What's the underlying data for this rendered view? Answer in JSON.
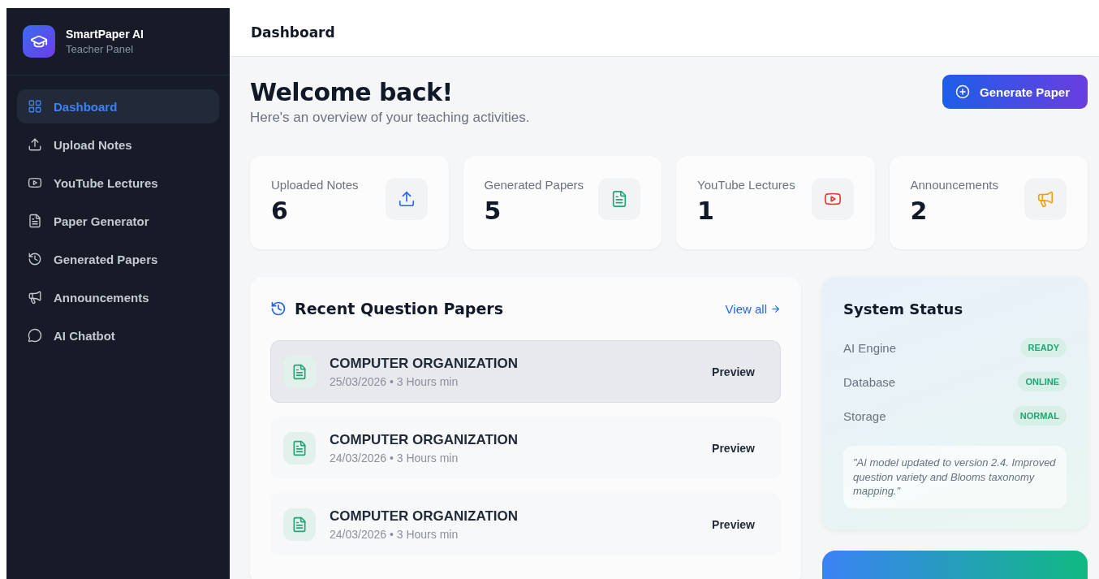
{
  "brand": {
    "title": "SmartPaper AI",
    "subtitle": "Teacher Panel"
  },
  "sidebar": {
    "items": [
      {
        "label": "Dashboard",
        "kind": "grid",
        "selected": true
      },
      {
        "label": "Upload Notes",
        "kind": "upload",
        "selected": false
      },
      {
        "label": "YouTube Lectures",
        "kind": "video",
        "selected": false
      },
      {
        "label": "Paper Generator",
        "kind": "document",
        "selected": false
      },
      {
        "label": "Generated Papers",
        "kind": "history",
        "selected": false
      },
      {
        "label": "Announcements",
        "kind": "megaphone",
        "selected": false
      },
      {
        "label": "AI Chatbot",
        "kind": "chat",
        "selected": false
      }
    ]
  },
  "header": {
    "title": "Dashboard"
  },
  "welcome": {
    "title": "Welcome back!",
    "subtitle": "Here's an overview of your teaching activities."
  },
  "primary_button": "Generate Paper",
  "stats": [
    {
      "label": "Uploaded Notes",
      "value": "6",
      "kind": "upload"
    },
    {
      "label": "Generated Papers",
      "value": "5",
      "kind": "document"
    },
    {
      "label": "YouTube Lectures",
      "value": "1",
      "kind": "video"
    },
    {
      "label": "Announcements",
      "value": "2",
      "kind": "megaphone"
    }
  ],
  "recent_papers": {
    "title": "Recent Question Papers",
    "link": "View all",
    "items": [
      {
        "title": "COMPUTER ORGANIZATION",
        "meta": "25/03/2026 • 3 Hours min",
        "action": "Preview",
        "selected": true
      },
      {
        "title": "COMPUTER ORGANIZATION",
        "meta": "24/03/2026 • 3 Hours min",
        "action": "Preview",
        "selected": false
      },
      {
        "title": "COMPUTER ORGANIZATION",
        "meta": "24/03/2026 • 3 Hours min",
        "action": "Preview",
        "selected": false
      }
    ]
  },
  "system_status": {
    "title": "System Status",
    "items": [
      {
        "label": "AI Engine",
        "status": "READY"
      },
      {
        "label": "Database",
        "status": "ONLINE"
      },
      {
        "label": "Storage",
        "status": "NORMAL"
      }
    ],
    "note": "\"AI model updated to version 2.4. Improved question variety and Blooms taxonomy mapping.\""
  }
}
